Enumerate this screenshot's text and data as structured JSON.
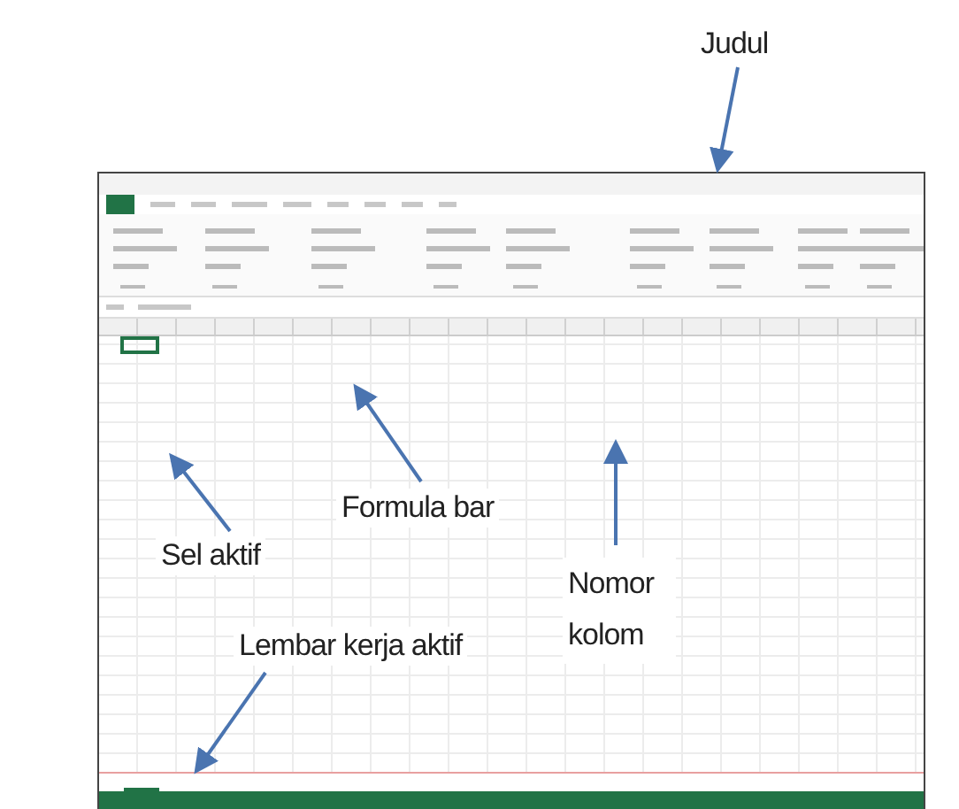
{
  "annotations": [
    {
      "label": "Judul",
      "kind": "title"
    },
    {
      "label": "Formula bar",
      "kind": "formula"
    },
    {
      "label": "Sel aktif",
      "kind": "cell"
    },
    {
      "label": "Nomor kolom",
      "kind": "column"
    },
    {
      "label": "Lembar kerja aktif",
      "kind": "sheet"
    }
  ]
}
